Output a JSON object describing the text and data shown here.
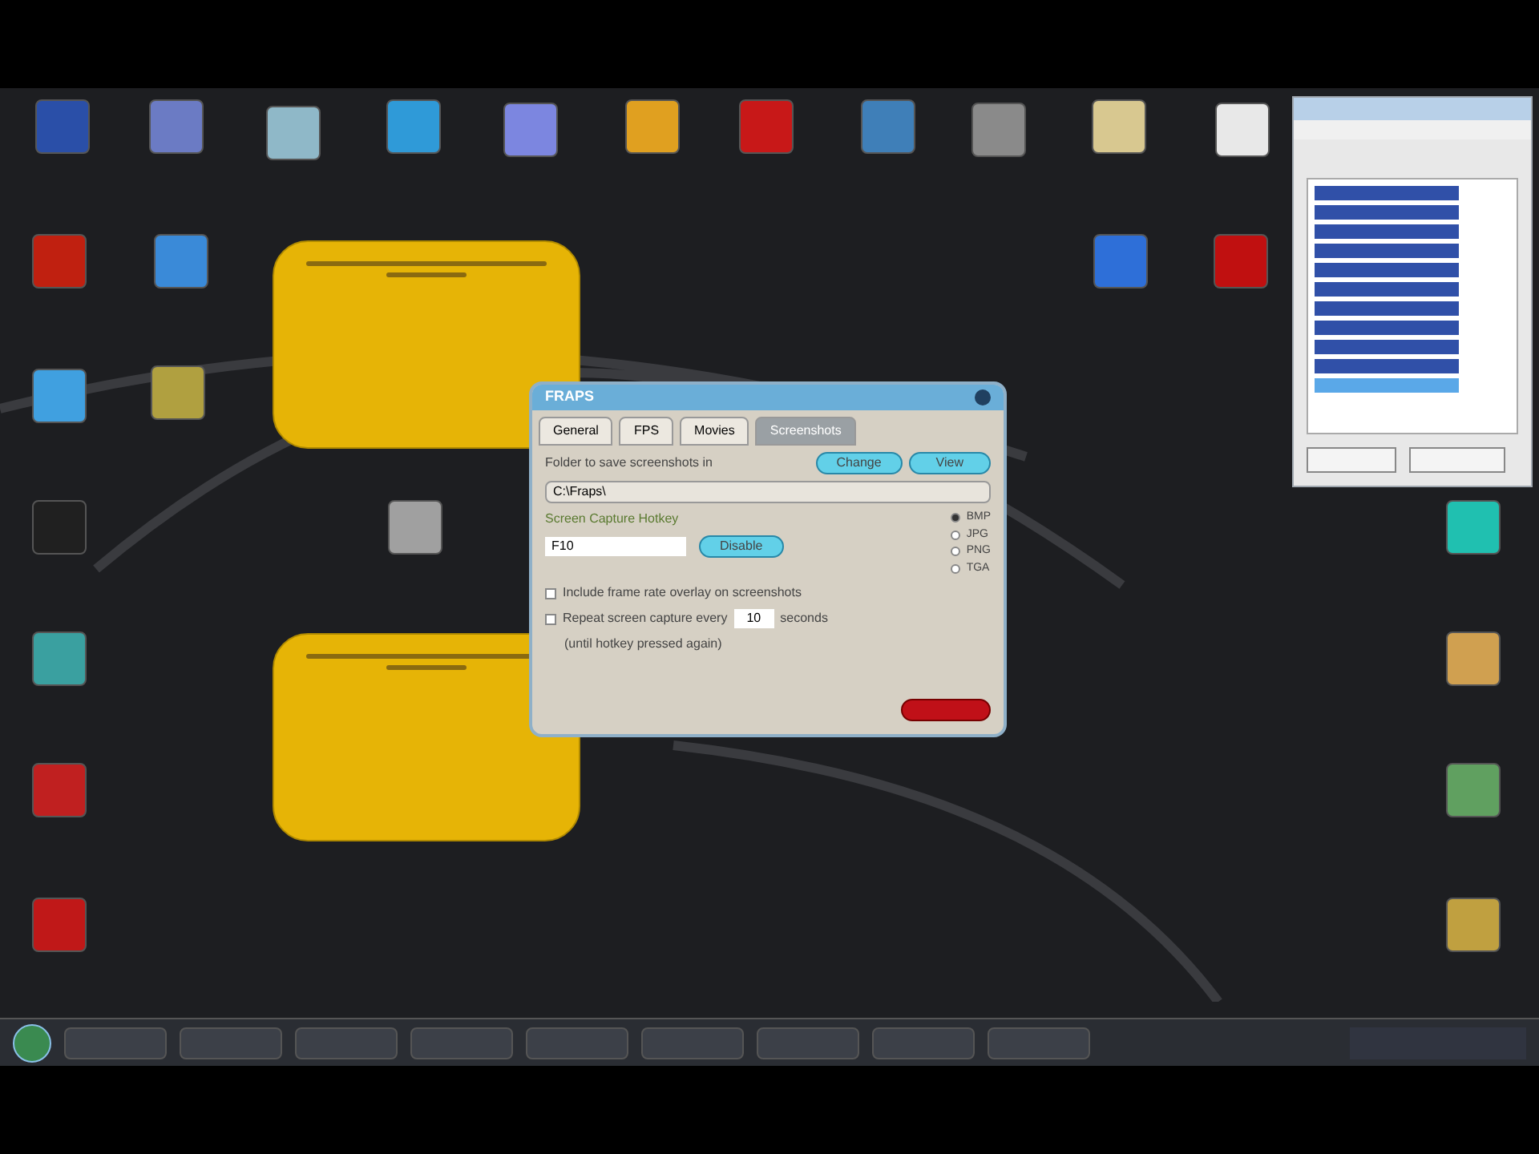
{
  "fraps_window": {
    "title": "FRAPS",
    "tabs": [
      {
        "label": "General",
        "selected": false
      },
      {
        "label": "FPS",
        "selected": false
      },
      {
        "label": "Movies",
        "selected": false
      },
      {
        "label": "Screenshots",
        "selected": true
      }
    ],
    "folder_label": "Folder to save screenshots in",
    "change_button": "Change",
    "view_button": "View",
    "folder_path": "C:\\Fraps\\",
    "hotkey_label": "Screen Capture Hotkey",
    "hotkey_value": "F10",
    "disable_button": "Disable",
    "formats": [
      {
        "label": "BMP",
        "selected": true
      },
      {
        "label": "JPG",
        "selected": false
      },
      {
        "label": "PNG",
        "selected": false
      },
      {
        "label": "TGA",
        "selected": false
      }
    ],
    "options": [
      {
        "label": "Include frame rate overlay on screenshots",
        "checked": false
      },
      {
        "label": "Repeat screen capture every",
        "checked": false
      }
    ],
    "repeat_seconds": "10",
    "seconds_label": "seconds",
    "repeat_note": "(until hotkey pressed again)"
  }
}
